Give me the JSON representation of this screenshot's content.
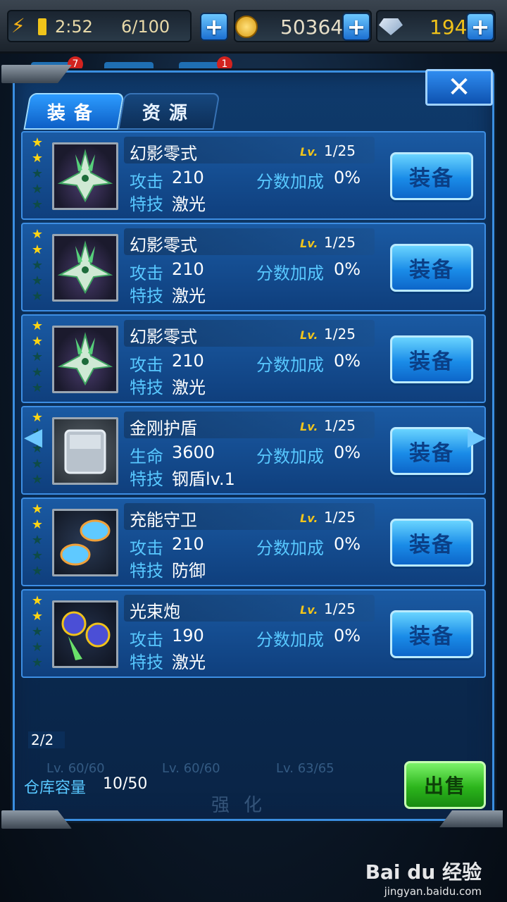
{
  "topbar": {
    "time": "2:52",
    "energy": "6/100",
    "gold": "50364",
    "gems": "194"
  },
  "tabs": [
    {
      "label": "装备",
      "active": true
    },
    {
      "label": "资源",
      "active": false
    }
  ],
  "items": [
    {
      "name": "幻影零式",
      "stars": 2,
      "lv_label": "Lv.",
      "level": "1/25",
      "stat_label": "攻击",
      "stat_value": "210",
      "bonus_label": "分数加成",
      "bonus_value": "0%",
      "skill_label": "特技",
      "skill_value": "激光",
      "button": "装备",
      "icon": "fighter-jet-icon"
    },
    {
      "name": "幻影零式",
      "stars": 2,
      "lv_label": "Lv.",
      "level": "1/25",
      "stat_label": "攻击",
      "stat_value": "210",
      "bonus_label": "分数加成",
      "bonus_value": "0%",
      "skill_label": "特技",
      "skill_value": "激光",
      "button": "装备",
      "icon": "fighter-jet-icon"
    },
    {
      "name": "幻影零式",
      "stars": 2,
      "lv_label": "Lv.",
      "level": "1/25",
      "stat_label": "攻击",
      "stat_value": "210",
      "bonus_label": "分数加成",
      "bonus_value": "0%",
      "skill_label": "特技",
      "skill_value": "激光",
      "button": "装备",
      "icon": "fighter-jet-icon"
    },
    {
      "name": "金刚护盾",
      "stars": 1,
      "lv_label": "Lv.",
      "level": "1/25",
      "stat_label": "生命",
      "stat_value": "3600",
      "bonus_label": "分数加成",
      "bonus_value": "0%",
      "skill_label": "特技",
      "skill_value": "钢盾lv.1",
      "button": "装备",
      "icon": "shield-icon"
    },
    {
      "name": "充能守卫",
      "stars": 2,
      "lv_label": "Lv.",
      "level": "1/25",
      "stat_label": "攻击",
      "stat_value": "210",
      "bonus_label": "分数加成",
      "bonus_value": "0%",
      "skill_label": "特技",
      "skill_value": "防御",
      "button": "装备",
      "icon": "drone-guard-icon"
    },
    {
      "name": "光束炮",
      "stars": 2,
      "lv_label": "Lv.",
      "level": "1/25",
      "stat_label": "攻击",
      "stat_value": "190",
      "bonus_label": "分数加成",
      "bonus_value": "0%",
      "skill_label": "特技",
      "skill_value": "激光",
      "button": "装备",
      "icon": "beam-cannon-icon"
    }
  ],
  "page": "2/2",
  "background_labels": {
    "lv1": "Lv. 60/60",
    "lv2": "Lv. 60/60",
    "lv3": "Lv. 63/65",
    "strengthen": "强化"
  },
  "capacity": {
    "label": "仓库容量",
    "value": "10/50"
  },
  "sell_button": "出售",
  "watermark": {
    "brand": "Bai du 经验",
    "url": "jingyan.baidu.com"
  },
  "colors": {
    "accent_blue": "#58c8ff",
    "star_on": "#ffd514",
    "gem_count": "#f0c21a",
    "sell_green": "#2cb51c"
  }
}
